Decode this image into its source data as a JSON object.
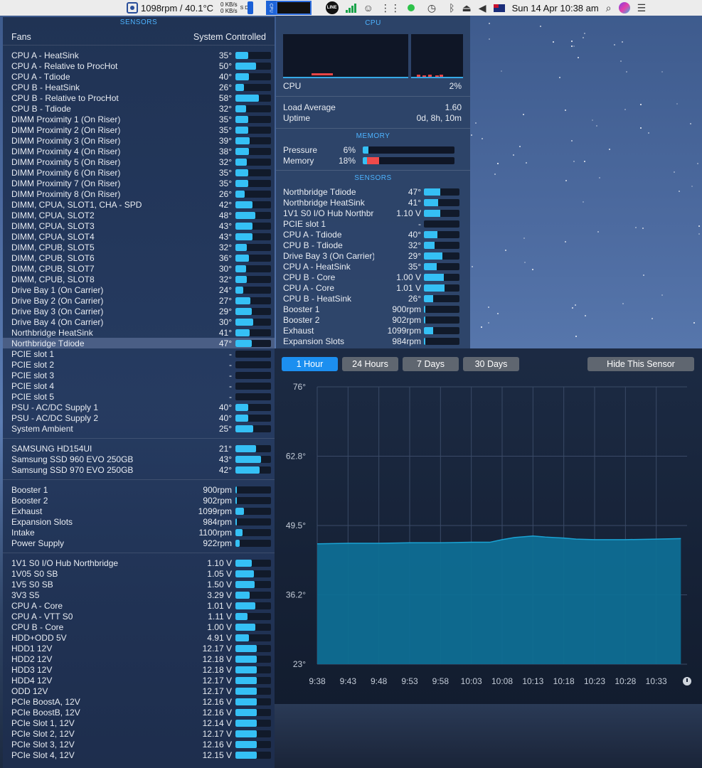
{
  "menubar": {
    "fan_readout": "1098rpm / 40.1°C",
    "net_up": "0 KB/s",
    "net_down": "0 KB/s",
    "disk_labels": "S D",
    "line_label": "LINE",
    "datetime": "Sun 14 Apr  10:38 am",
    "icons": [
      "fan-icon",
      "network-icon",
      "battery-icon",
      "cpu-icon",
      "line-app-icon",
      "signal-icon",
      "emoji-icon",
      "grip-icon",
      "green-dot-icon",
      "time-machine-icon",
      "bluetooth-icon",
      "eject-icon",
      "volume-icon",
      "flag-icon",
      "search-icon",
      "siri-icon",
      "list-icon"
    ]
  },
  "left": {
    "title": "SENSORS",
    "fans_label": "Fans",
    "fans_mode": "System Controlled",
    "temps": [
      {
        "name": "CPU A - HeatSink",
        "value": "35°",
        "pct": 35
      },
      {
        "name": "CPU A - Relative to ProcHot",
        "value": "50°",
        "pct": 58
      },
      {
        "name": "CPU A - Tdiode",
        "value": "40°",
        "pct": 38
      },
      {
        "name": "CPU B - HeatSink",
        "value": "26°",
        "pct": 24
      },
      {
        "name": "CPU B - Relative to ProcHot",
        "value": "58°",
        "pct": 66
      },
      {
        "name": "CPU B - Tdiode",
        "value": "32°",
        "pct": 30
      },
      {
        "name": "DIMM Proximity 1 (On Riser)",
        "value": "35°",
        "pct": 35
      },
      {
        "name": "DIMM Proximity 2 (On Riser)",
        "value": "35°",
        "pct": 35
      },
      {
        "name": "DIMM Proximity 3 (On Riser)",
        "value": "39°",
        "pct": 40
      },
      {
        "name": "DIMM Proximity 4 (On Riser)",
        "value": "38°",
        "pct": 38
      },
      {
        "name": "DIMM Proximity 5 (On Riser)",
        "value": "32°",
        "pct": 32
      },
      {
        "name": "DIMM Proximity 6 (On Riser)",
        "value": "35°",
        "pct": 35
      },
      {
        "name": "DIMM Proximity 7 (On Riser)",
        "value": "35°",
        "pct": 35
      },
      {
        "name": "DIMM Proximity 8 (On Riser)",
        "value": "26°",
        "pct": 25
      },
      {
        "name": "DIMM, CPUA, SLOT1, CHA - SPD",
        "value": "42°",
        "pct": 48
      },
      {
        "name": "DIMM, CPUA, SLOT2",
        "value": "48°",
        "pct": 55
      },
      {
        "name": "DIMM, CPUA, SLOT3",
        "value": "43°",
        "pct": 48
      },
      {
        "name": "DIMM, CPUA, SLOT4",
        "value": "43°",
        "pct": 48
      },
      {
        "name": "DIMM, CPUB, SLOT5",
        "value": "32°",
        "pct": 32
      },
      {
        "name": "DIMM, CPUB, SLOT6",
        "value": "36°",
        "pct": 38
      },
      {
        "name": "DIMM, CPUB, SLOT7",
        "value": "30°",
        "pct": 30
      },
      {
        "name": "DIMM, CPUB, SLOT8",
        "value": "32°",
        "pct": 32
      },
      {
        "name": "Drive Bay 1 (On Carrier)",
        "value": "24°",
        "pct": 22
      },
      {
        "name": "Drive Bay 2 (On Carrier)",
        "value": "27°",
        "pct": 42
      },
      {
        "name": "Drive Bay 3 (On Carrier)",
        "value": "29°",
        "pct": 46
      },
      {
        "name": "Drive Bay 4 (On Carrier)",
        "value": "30°",
        "pct": 50
      },
      {
        "name": "Northbridge HeatSink",
        "value": "41°",
        "pct": 40
      },
      {
        "name": "Northbridge Tdiode",
        "value": "47°",
        "pct": 46
      },
      {
        "name": "PCIE slot 1",
        "value": "-",
        "pct": 0
      },
      {
        "name": "PCIE slot 2",
        "value": "-",
        "pct": 0
      },
      {
        "name": "PCIE slot 3",
        "value": "-",
        "pct": 0
      },
      {
        "name": "PCIE slot 4",
        "value": "-",
        "pct": 0
      },
      {
        "name": "PCIE slot 5",
        "value": "-",
        "pct": 0
      },
      {
        "name": "PSU - AC/DC Supply 1",
        "value": "40°",
        "pct": 36
      },
      {
        "name": "PSU - AC/DC Supply 2",
        "value": "40°",
        "pct": 36
      },
      {
        "name": "System Ambient",
        "value": "25°",
        "pct": 50
      }
    ],
    "drives": [
      {
        "name": "SAMSUNG HD154UI",
        "value": "21°",
        "pct": 58
      },
      {
        "name": "Samsung SSD 960 EVO 250GB",
        "value": "43°",
        "pct": 72
      },
      {
        "name": "Samsung SSD 970 EVO 250GB",
        "value": "42°",
        "pct": 68
      }
    ],
    "fans": [
      {
        "name": "Booster 1",
        "value": "900rpm",
        "pct": 4
      },
      {
        "name": "Booster 2",
        "value": "902rpm",
        "pct": 4
      },
      {
        "name": "Exhaust",
        "value": "1099rpm",
        "pct": 24
      },
      {
        "name": "Expansion Slots",
        "value": "984rpm",
        "pct": 4
      },
      {
        "name": "Intake",
        "value": "1100rpm",
        "pct": 20
      },
      {
        "name": "Power Supply",
        "value": "922rpm",
        "pct": 12
      }
    ],
    "voltages": [
      {
        "name": "1V1 S0 I/O Hub Northbridge",
        "value": "1.10 V",
        "pct": 46
      },
      {
        "name": "1V05 S0 SB",
        "value": "1.05 V",
        "pct": 52
      },
      {
        "name": "1V5 S0 SB",
        "value": "1.50 V",
        "pct": 54
      },
      {
        "name": "3V3 S5",
        "value": "3.29 V",
        "pct": 40
      },
      {
        "name": "CPU A - Core",
        "value": "1.01 V",
        "pct": 56
      },
      {
        "name": "CPU A - VTT S0",
        "value": "1.11 V",
        "pct": 34
      },
      {
        "name": "CPU B - Core",
        "value": "1.00 V",
        "pct": 56
      },
      {
        "name": "HDD+ODD 5V",
        "value": "4.91 V",
        "pct": 38
      },
      {
        "name": "HDD1 12V",
        "value": "12.17 V",
        "pct": 60
      },
      {
        "name": "HDD2 12V",
        "value": "12.18 V",
        "pct": 60
      },
      {
        "name": "HDD3 12V",
        "value": "12.18 V",
        "pct": 60
      },
      {
        "name": "HDD4 12V",
        "value": "12.17 V",
        "pct": 60
      },
      {
        "name": "ODD 12V",
        "value": "12.17 V",
        "pct": 60
      },
      {
        "name": "PCIe BoostA, 12V",
        "value": "12.16 V",
        "pct": 60
      },
      {
        "name": "PCIe BoostB, 12V",
        "value": "12.16 V",
        "pct": 60
      },
      {
        "name": "PCIe Slot 1, 12V",
        "value": "12.14 V",
        "pct": 60
      },
      {
        "name": "PCIe Slot 2, 12V",
        "value": "12.17 V",
        "pct": 60
      },
      {
        "name": "PCIe Slot 3, 12V",
        "value": "12.16 V",
        "pct": 60
      },
      {
        "name": "PCIe Slot 4, 12V",
        "value": "12.15 V",
        "pct": 60
      }
    ]
  },
  "right": {
    "cpu_title": "CPU",
    "cpu_label": "CPU",
    "cpu_value": "2%",
    "load_label": "Load Average",
    "load_value": "1.60",
    "uptime_label": "Uptime",
    "uptime_value": "0d, 8h, 10m",
    "memory_title": "MEMORY",
    "pressure_label": "Pressure",
    "pressure_value": "6%",
    "pressure_pct": 6,
    "memory_label": "Memory",
    "memory_value": "18%",
    "memory_blue_pct": 5,
    "memory_red_pct": 13,
    "sensors_title": "SENSORS",
    "sensors": [
      {
        "name": "Northbridge Tdiode",
        "value": "47°",
        "pct": 46
      },
      {
        "name": "Northbridge HeatSink",
        "value": "41°",
        "pct": 40
      },
      {
        "name": "1V1 S0 I/O Hub Northbridge",
        "value": "1.10 V",
        "pct": 46
      },
      {
        "name": "PCIE slot 1",
        "value": "-",
        "pct": 0
      },
      {
        "name": "CPU A - Tdiode",
        "value": "40°",
        "pct": 38
      },
      {
        "name": "CPU B - Tdiode",
        "value": "32°",
        "pct": 30
      },
      {
        "name": "Drive Bay 3 (On Carrier)",
        "value": "29°",
        "pct": 52
      },
      {
        "name": "CPU A - HeatSink",
        "value": "35°",
        "pct": 35
      },
      {
        "name": "CPU B - Core",
        "value": "1.00 V",
        "pct": 56
      },
      {
        "name": "CPU A - Core",
        "value": "1.01 V",
        "pct": 58
      },
      {
        "name": "CPU B - HeatSink",
        "value": "26°",
        "pct": 26
      },
      {
        "name": "Booster 1",
        "value": "900rpm",
        "pct": 4
      },
      {
        "name": "Booster 2",
        "value": "902rpm",
        "pct": 4
      },
      {
        "name": "Exhaust",
        "value": "1099rpm",
        "pct": 26
      },
      {
        "name": "Expansion Slots",
        "value": "984rpm",
        "pct": 4
      }
    ]
  },
  "history": {
    "tabs": [
      "1 Hour",
      "24 Hours",
      "7 Days",
      "30 Days"
    ],
    "active_tab": 0,
    "hide_label": "Hide This Sensor",
    "colors": {
      "fill": "#0e6e94",
      "line": "#1aa3d4",
      "grid": "#3a4a66",
      "active_tab": "#1c8ff0"
    }
  },
  "chart_data": {
    "type": "area",
    "title": "",
    "xlabel": "",
    "ylabel": "",
    "x_ticks": [
      "9:38",
      "9:43",
      "9:48",
      "9:53",
      "9:58",
      "10:03",
      "10:08",
      "10:13",
      "10:18",
      "10:23",
      "10:28",
      "10:33"
    ],
    "y_ticks": [
      "76°",
      "62.8°",
      "49.5°",
      "36.2°",
      "23°"
    ],
    "ylim": [
      23,
      76
    ],
    "grid": true,
    "series": [
      {
        "x": [
          "9:38",
          "9:43",
          "9:48",
          "9:53",
          "9:58",
          "10:03",
          "10:06",
          "10:08",
          "10:10",
          "10:13",
          "10:15",
          "10:18",
          "10:20",
          "10:23",
          "10:28",
          "10:33",
          "10:37"
        ],
        "values": [
          46.0,
          46.1,
          46.1,
          46.2,
          46.2,
          46.3,
          46.3,
          46.8,
          47.2,
          47.5,
          47.3,
          47.1,
          46.9,
          46.8,
          46.8,
          46.9,
          47.0
        ]
      }
    ]
  }
}
